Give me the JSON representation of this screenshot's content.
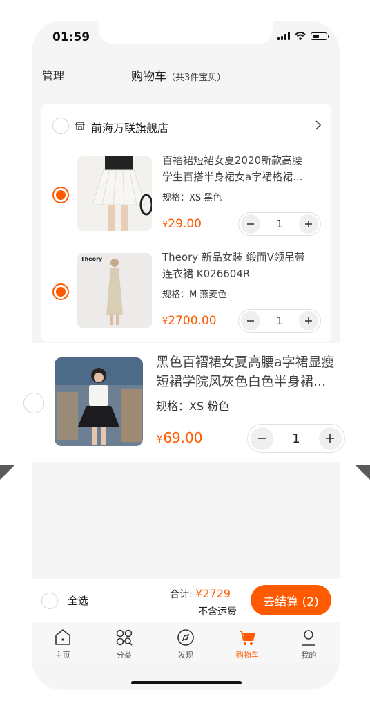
{
  "status": {
    "time": "01:59"
  },
  "header": {
    "manage": "管理",
    "title": "购物车",
    "count": "（共3件宝贝）"
  },
  "shop": {
    "name": "前海万联旗舰店"
  },
  "items": [
    {
      "title_line1": "百褶裙短裙女夏2020新款高腰",
      "title_line2": "学生百搭半身裙女a字裙格裙...",
      "spec": "规格：XS 黑色",
      "currency": "¥",
      "price": "29.00",
      "qty": "1",
      "selected": true
    },
    {
      "title_line1": "Theory 新品女装 缎面V领吊带",
      "title_line2": "连衣裙 K026604R",
      "spec": "规格：M 燕麦色",
      "currency": "¥",
      "price": "2700.00",
      "qty": "1",
      "selected": true,
      "thumb_text": "Theory"
    },
    {
      "title_line1": "黑色百褶裙女夏高腰a字裙显瘦",
      "title_line2": "短裙学院风灰色白色半身裙...",
      "spec": "规格：XS 粉色",
      "currency": "¥",
      "price": "69.00",
      "qty": "1",
      "selected": false
    }
  ],
  "checkout": {
    "select_all": "全选",
    "total_label": "合计:",
    "total_value": "¥2729",
    "freight": "不含运费",
    "button": "去结算 (2)"
  },
  "tabs": [
    {
      "label": "主页",
      "icon": "home-icon"
    },
    {
      "label": "分类",
      "icon": "category-icon"
    },
    {
      "label": "发现",
      "icon": "compass-icon"
    },
    {
      "label": "购物车",
      "icon": "cart-icon",
      "active": true
    },
    {
      "label": "我的",
      "icon": "user-icon"
    }
  ],
  "colors": {
    "accent": "#ff5a00",
    "background": "#f5f5f5"
  }
}
